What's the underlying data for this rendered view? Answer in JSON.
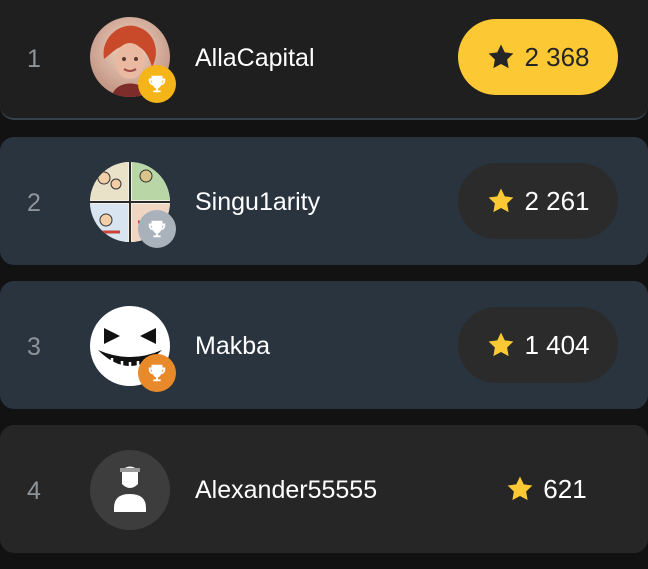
{
  "leaderboard": {
    "rows": [
      {
        "rank": "1",
        "username": "AllaCapital",
        "score": "2 368",
        "medal": "gold",
        "avatar": "photo-woman"
      },
      {
        "rank": "2",
        "username": "Singu1arity",
        "score": "2 261",
        "medal": "silver",
        "avatar": "comic-collage"
      },
      {
        "rank": "3",
        "username": "Makba",
        "score": "1 404",
        "medal": "bronze",
        "avatar": "grin-face"
      },
      {
        "rank": "4",
        "username": "Alexander55555",
        "score": "621",
        "medal": "none",
        "avatar": "default-user"
      }
    ]
  },
  "colors": {
    "gold_pill": "#fcc934",
    "dark_pill": "#2b2b2b",
    "star": "#fcc934",
    "silver_badge": "#a9b1bb",
    "bronze_badge": "#e8892a",
    "gold_badge": "#f5b418"
  },
  "icons": {
    "score": "star-icon",
    "medal": "trophy-icon",
    "default_avatar": "user-icon"
  }
}
